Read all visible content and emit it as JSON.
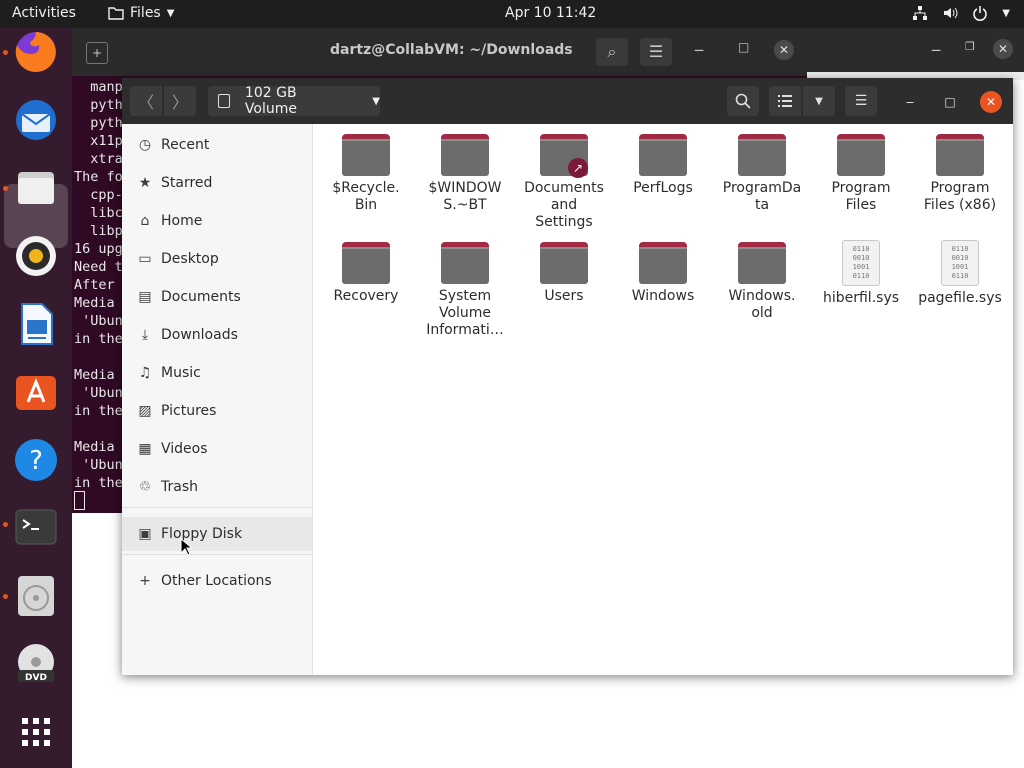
{
  "topbar": {
    "activities": "Activities",
    "app_menu": "Files",
    "clock": "Apr 10  11:42"
  },
  "terminal": {
    "title": "dartz@CollabVM: ~/Downloads",
    "lines": [
      "  manp",
      "  pyth",
      "  pyth",
      "  x11p",
      "  xtra",
      "The fo",
      "  cpp-",
      "  libc",
      "  libp",
      "16 upg",
      "Need t",
      "After",
      "Media",
      " 'Ubun",
      "in the",
      "",
      "Media",
      " 'Ubun",
      "in the",
      "",
      "Media",
      " 'Ubun",
      "in the"
    ]
  },
  "files": {
    "location": "102 GB Volume",
    "sidebar": [
      {
        "label": "Recent",
        "icon": "clock-icon",
        "glyph": "◷"
      },
      {
        "label": "Starred",
        "icon": "star-icon",
        "glyph": "★"
      },
      {
        "label": "Home",
        "icon": "home-icon",
        "glyph": "⌂"
      },
      {
        "label": "Desktop",
        "icon": "desktop-icon",
        "glyph": "▭"
      },
      {
        "label": "Documents",
        "icon": "document-icon",
        "glyph": "▤"
      },
      {
        "label": "Downloads",
        "icon": "download-icon",
        "glyph": "⤓"
      },
      {
        "label": "Music",
        "icon": "music-icon",
        "glyph": "♫"
      },
      {
        "label": "Pictures",
        "icon": "picture-icon",
        "glyph": "▨"
      },
      {
        "label": "Videos",
        "icon": "video-icon",
        "glyph": "▦"
      },
      {
        "label": "Trash",
        "icon": "trash-icon",
        "glyph": "♲"
      },
      {
        "label": "Floppy Disk",
        "icon": "floppy-icon",
        "glyph": "▣"
      },
      {
        "label": "Other Locations",
        "icon": "plus-icon",
        "glyph": "+"
      }
    ],
    "items": [
      {
        "name": "$Recycle.\nBin",
        "type": "folder"
      },
      {
        "name": "$WINDOW\nS.~BT",
        "type": "folder"
      },
      {
        "name": "Documents\nand\nSettings",
        "type": "folder-link"
      },
      {
        "name": "PerfLogs",
        "type": "folder"
      },
      {
        "name": "ProgramDa\nta",
        "type": "folder"
      },
      {
        "name": "Program\nFiles",
        "type": "folder"
      },
      {
        "name": "Program\nFiles (x86)",
        "type": "folder"
      },
      {
        "name": "Recovery",
        "type": "folder"
      },
      {
        "name": "System\nVolume\nInformati…",
        "type": "folder"
      },
      {
        "name": "Users",
        "type": "folder"
      },
      {
        "name": "Windows",
        "type": "folder"
      },
      {
        "name": "Windows.\nold",
        "type": "folder"
      },
      {
        "name": "hiberfil.sys",
        "type": "binary"
      },
      {
        "name": "pagefile.sys",
        "type": "binary"
      }
    ]
  },
  "dock": [
    {
      "name": "firefox-icon",
      "color": "#e66000"
    },
    {
      "name": "thunderbird-icon",
      "color": "#2a6fc9"
    },
    {
      "name": "files-icon",
      "color": "#c9c9c9"
    },
    {
      "name": "rhythmbox-icon",
      "color": "#e8b817"
    },
    {
      "name": "libreoffice-writer-icon",
      "color": "#2a74c9"
    },
    {
      "name": "app-center-icon",
      "color": "#e95420"
    },
    {
      "name": "help-icon",
      "color": "#1e88e5"
    },
    {
      "name": "terminal-icon",
      "color": "#3c3c3c"
    },
    {
      "name": "disc-drive-icon",
      "color": "#bdbdbd"
    },
    {
      "name": "dvd-icon",
      "color": "#e8e8e8"
    },
    {
      "name": "show-apps-icon",
      "color": "#ffffff"
    }
  ]
}
